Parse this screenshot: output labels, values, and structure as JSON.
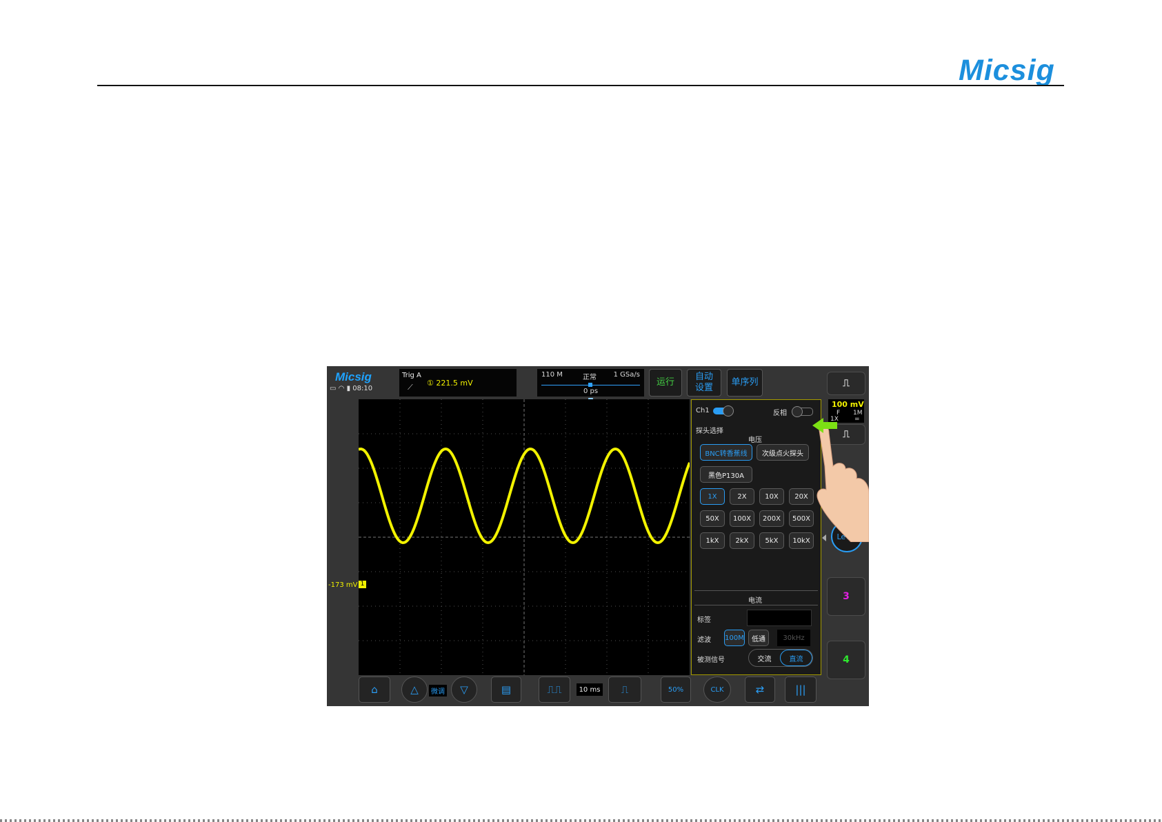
{
  "page": {
    "brand": "Micsig"
  },
  "scope": {
    "logo": "Micsig",
    "status_time": "08:10",
    "trigger": {
      "label": "Trig A",
      "source_badge": "①",
      "level": "221.5 mV"
    },
    "timebar": {
      "memory": "110 M",
      "mode": "正常",
      "sample_rate": "1 GSa/s",
      "delay": "0 ps"
    },
    "buttons": {
      "run": "运行",
      "auto_line1": "自动",
      "auto_line2": "设置",
      "single": "单序列"
    },
    "offset_label": "-173 mV",
    "channel_marker": "1",
    "waveform": {
      "color": "#f2f200",
      "cycles_visible": 3.9
    },
    "panel": {
      "ch_label": "Ch1",
      "invert_label": "反相",
      "probe_select": "探头选择",
      "voltage_header": "电压",
      "probe_types": [
        "BNC转香蕉线",
        "次级点火探头",
        "黑色P130A"
      ],
      "attenuations": [
        "1X",
        "2X",
        "10X",
        "20X",
        "50X",
        "100X",
        "200X",
        "500X",
        "1kX",
        "2kX",
        "5kX",
        "10kX"
      ],
      "current_header": "电流",
      "tag_label": "标签",
      "filter_label": "滤波",
      "filter_options": [
        "100M",
        "低通"
      ],
      "filter_value": "30kHz",
      "signal_label": "被测信号",
      "coupling_options": [
        "交流",
        "直流"
      ]
    },
    "side": {
      "ch1_scale": "100 mV",
      "ch1_f": "F",
      "ch1_imp": "1M",
      "ch1_probe": "1X",
      "ch1_coupling": "=",
      "level_label": "Level",
      "ch3": "3",
      "ch4": "4"
    },
    "bottom": {
      "fine": "微调",
      "timebase": "10 ms",
      "fifty_pct": "50%",
      "clk": "CLK"
    }
  }
}
